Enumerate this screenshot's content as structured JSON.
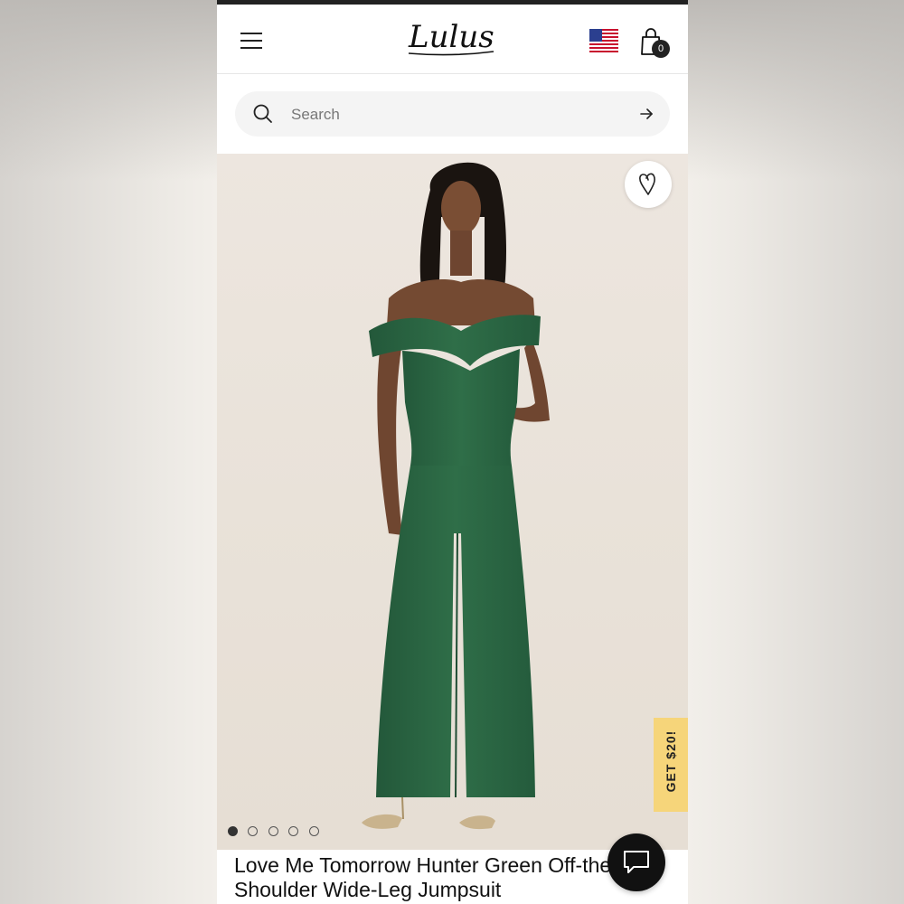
{
  "header": {
    "logo": "Lulus",
    "region_icon": "us-flag-icon",
    "cart_count": "0"
  },
  "search": {
    "placeholder": "Search"
  },
  "product": {
    "title": "Love Me Tomorrow Hunter Green Off-the-Shoulder Wide-Leg Jumpsuit",
    "image_count": 5,
    "active_image": 1
  },
  "promo": {
    "label": "GET $20!"
  },
  "colors": {
    "promo_bg": "#f6d57a",
    "jumpsuit_green": "#2d6a45",
    "dark": "#111111"
  }
}
